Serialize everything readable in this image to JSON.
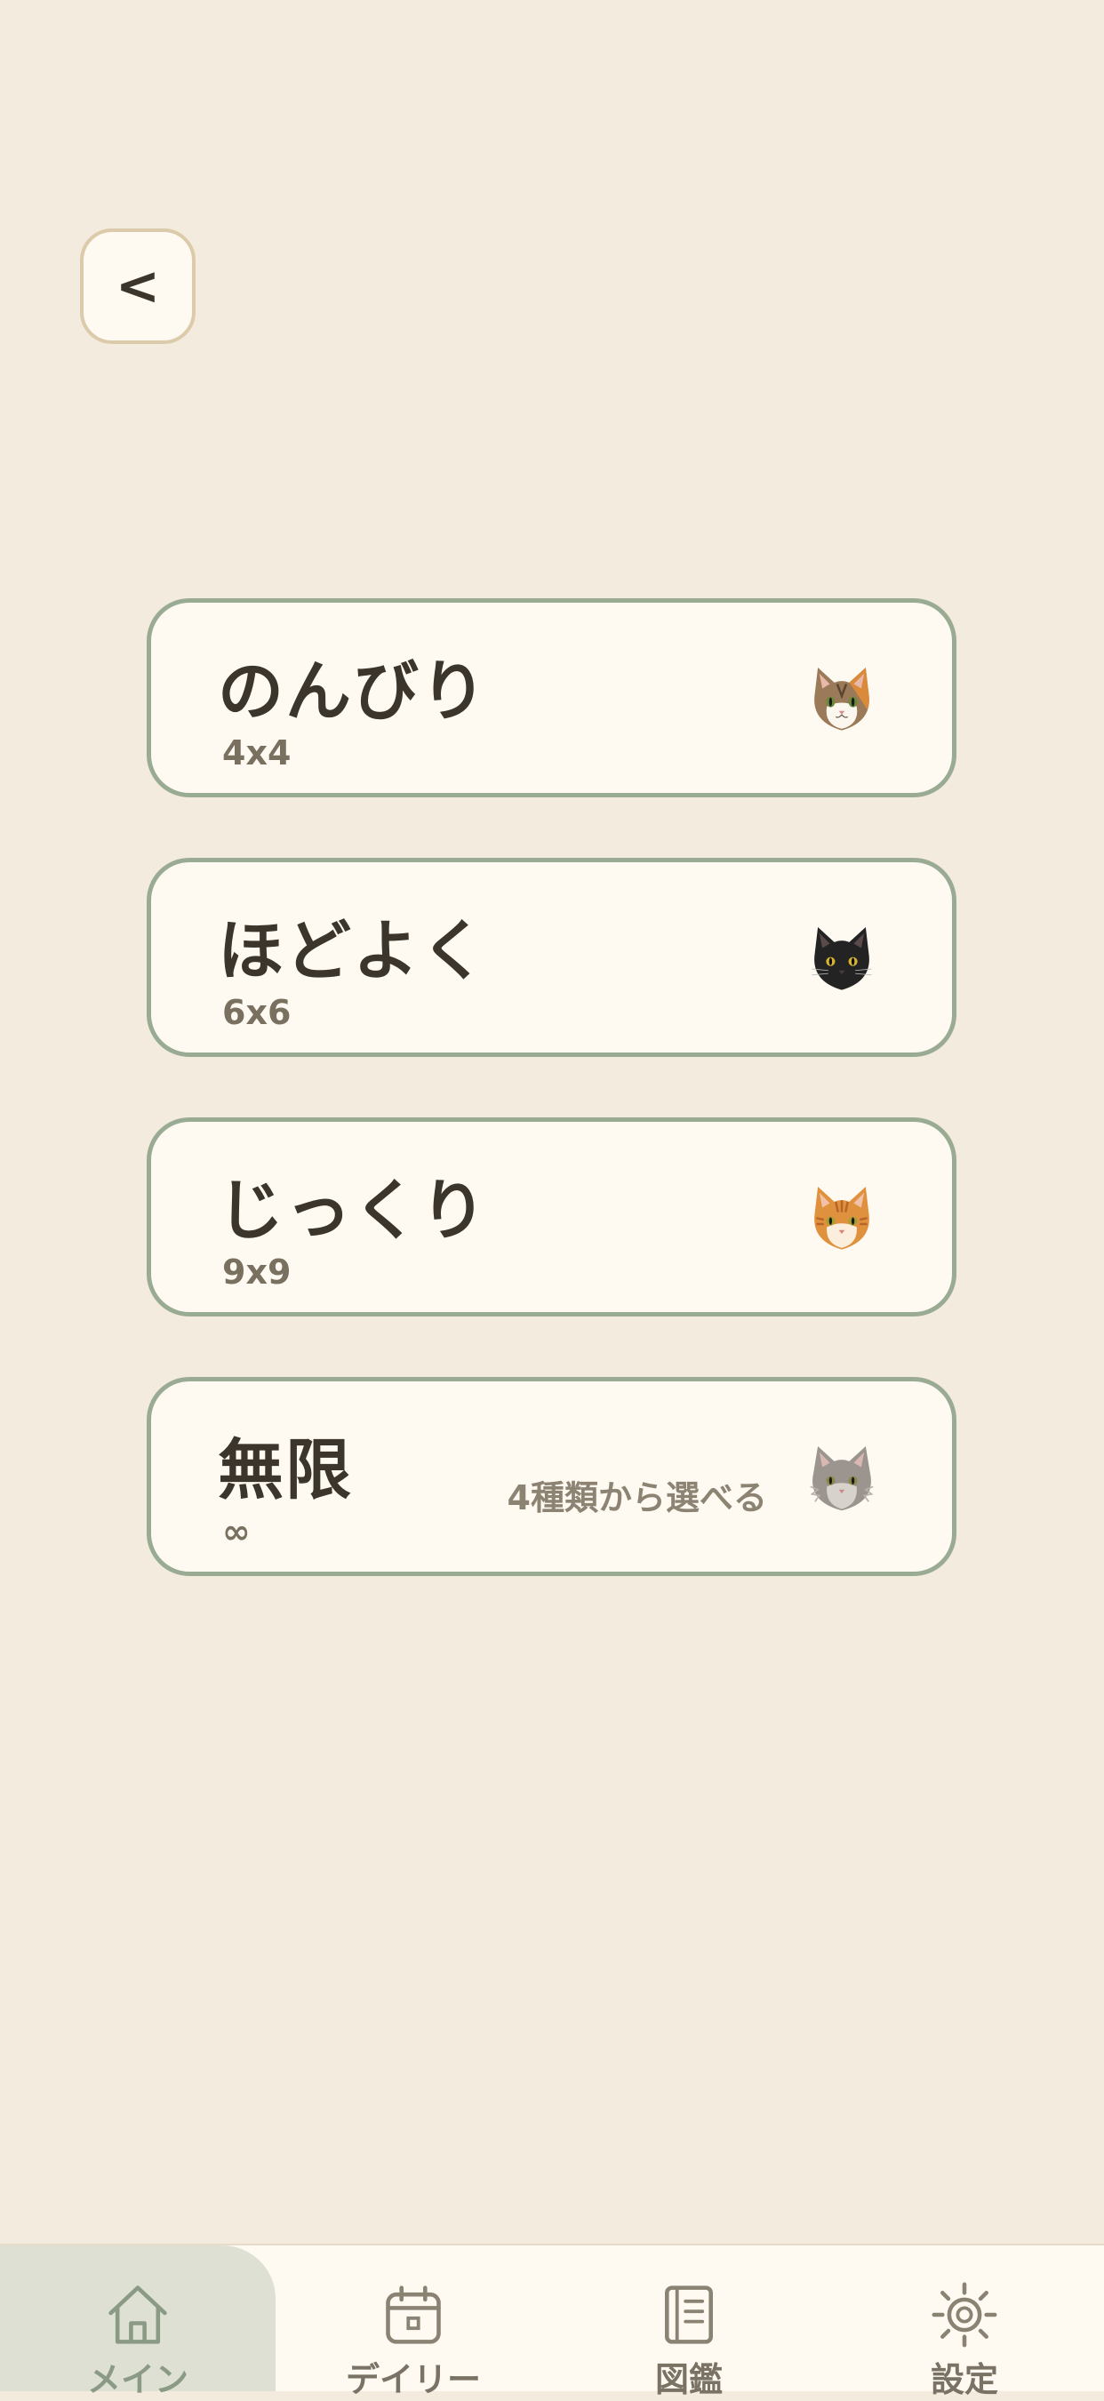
{
  "header": {
    "back_label": "<"
  },
  "modes": [
    {
      "title": "のんびり",
      "size": "4x4",
      "note": "",
      "cat": "tabby-calico-cat-icon"
    },
    {
      "title": "ほどよく",
      "size": "6x6",
      "note": "",
      "cat": "black-cat-icon"
    },
    {
      "title": "じっくり",
      "size": "9x9",
      "note": "",
      "cat": "orange-tabby-cat-icon"
    },
    {
      "title": "無限",
      "size": "∞",
      "note": "4種類から選べる",
      "cat": "gray-longhair-cat-icon"
    }
  ],
  "tabbar": {
    "tabs": [
      {
        "label": "メイン",
        "icon": "home-icon",
        "active": true
      },
      {
        "label": "デイリー",
        "icon": "calendar-icon",
        "active": false
      },
      {
        "label": "図鑑",
        "icon": "book-icon",
        "active": false
      },
      {
        "label": "設定",
        "icon": "gear-icon",
        "active": false
      }
    ]
  },
  "colors": {
    "background": "#f3ebde",
    "card_fill": "#fefaf2",
    "card_border": "#9aab94",
    "active_tab": "#dde0d2"
  }
}
